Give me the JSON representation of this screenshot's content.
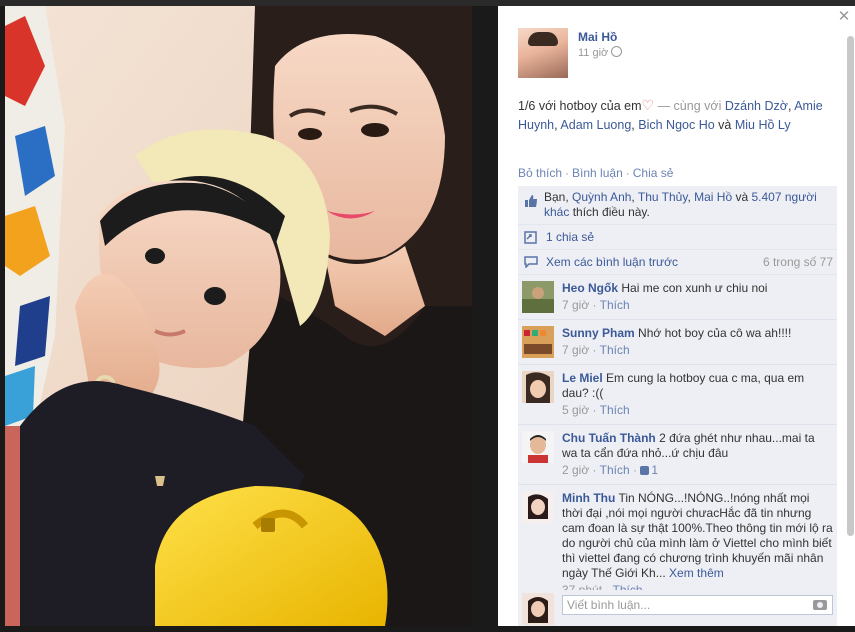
{
  "photo": {
    "alt": "photo"
  },
  "post": {
    "author": "Mai Hồ",
    "time": "11 giờ",
    "caption_prefix": "1/6 với hotboy của em",
    "caption_mid": " — cùng với ",
    "tags": [
      "Dzánh Dzờ",
      "Amie Huynh",
      "Adam Luong",
      "Bich Ngoc Ho",
      "Miu Hồ Ly"
    ],
    "sep_comma": ", ",
    "and_word": " và "
  },
  "actions": {
    "like": "Bỏ thích",
    "comment": "Bình luận",
    "share": "Chia sẻ",
    "dot": "·"
  },
  "likes": {
    "prefix": "Bạn, ",
    "names": [
      "Quỳnh Anh",
      "Thu Thủy",
      "Mai Hồ"
    ],
    "and_word": " và ",
    "others": "5.407 người khác",
    "suffix": " thích điều này."
  },
  "shares": {
    "label": "1 chia sẻ"
  },
  "previous": {
    "label": "Xem các bình luận trước",
    "count": "6 trong số 77"
  },
  "comments": [
    {
      "name": "Heo Ngốk",
      "text": "Hai me con xunh ư chiu noi",
      "time": "7 giờ",
      "like": "Thích",
      "likes": "",
      "more": ""
    },
    {
      "name": "Sunny Pham",
      "text": "Nhớ hot boy của cô wa ah!!!!",
      "time": "7 giờ",
      "like": "Thích",
      "likes": "",
      "more": ""
    },
    {
      "name": "Le Miel",
      "text": "Em cung la hotboy cua c ma, qua em dau? :((",
      "time": "5 giờ",
      "like": "Thích",
      "likes": "",
      "more": ""
    },
    {
      "name": "Chu Tuấn Thành",
      "text": "2 đứa ghét như nhau...mai ta wa ta cẩn đứa nhỏ...ứ chịu đâu",
      "time": "2 giờ",
      "like": "Thích",
      "likes": "1",
      "more": ""
    },
    {
      "name": "Minh Thu",
      "text": "Tin NÓNG...!NÓNG..!nóng nhất mọi thời đại ,nói mọi người chưacHắc đã tin nhưng cam đoan là sự thật 100%.Theo thông tin mới lộ ra do người chủ của mình làm ở Viettel cho mình biết thì viettel đang có chương trình khuyến mãi nhân ngày Thế Giới Kh...",
      "time": "37 phút",
      "like": "Thích",
      "likes": "",
      "more": "Xem thêm"
    }
  ],
  "write": {
    "placeholder": "Viết bình luận..."
  },
  "icons": {
    "close": "close-icon",
    "globe": "globe-icon",
    "like": "like-icon",
    "share": "share-icon",
    "comments": "comments-icon",
    "camera": "camera-icon"
  },
  "colors": {
    "link": "#3b5998",
    "background": "#edeff4"
  }
}
